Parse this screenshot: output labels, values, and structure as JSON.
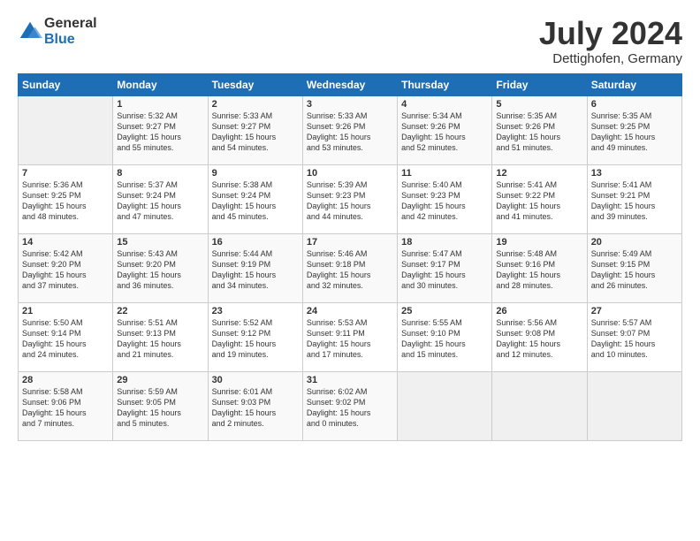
{
  "logo": {
    "general": "General",
    "blue": "Blue"
  },
  "header": {
    "month": "July 2024",
    "location": "Dettighofen, Germany"
  },
  "days_of_week": [
    "Sunday",
    "Monday",
    "Tuesday",
    "Wednesday",
    "Thursday",
    "Friday",
    "Saturday"
  ],
  "weeks": [
    [
      {
        "num": "",
        "info": ""
      },
      {
        "num": "1",
        "info": "Sunrise: 5:32 AM\nSunset: 9:27 PM\nDaylight: 15 hours\nand 55 minutes."
      },
      {
        "num": "2",
        "info": "Sunrise: 5:33 AM\nSunset: 9:27 PM\nDaylight: 15 hours\nand 54 minutes."
      },
      {
        "num": "3",
        "info": "Sunrise: 5:33 AM\nSunset: 9:26 PM\nDaylight: 15 hours\nand 53 minutes."
      },
      {
        "num": "4",
        "info": "Sunrise: 5:34 AM\nSunset: 9:26 PM\nDaylight: 15 hours\nand 52 minutes."
      },
      {
        "num": "5",
        "info": "Sunrise: 5:35 AM\nSunset: 9:26 PM\nDaylight: 15 hours\nand 51 minutes."
      },
      {
        "num": "6",
        "info": "Sunrise: 5:35 AM\nSunset: 9:25 PM\nDaylight: 15 hours\nand 49 minutes."
      }
    ],
    [
      {
        "num": "7",
        "info": "Sunrise: 5:36 AM\nSunset: 9:25 PM\nDaylight: 15 hours\nand 48 minutes."
      },
      {
        "num": "8",
        "info": "Sunrise: 5:37 AM\nSunset: 9:24 PM\nDaylight: 15 hours\nand 47 minutes."
      },
      {
        "num": "9",
        "info": "Sunrise: 5:38 AM\nSunset: 9:24 PM\nDaylight: 15 hours\nand 45 minutes."
      },
      {
        "num": "10",
        "info": "Sunrise: 5:39 AM\nSunset: 9:23 PM\nDaylight: 15 hours\nand 44 minutes."
      },
      {
        "num": "11",
        "info": "Sunrise: 5:40 AM\nSunset: 9:23 PM\nDaylight: 15 hours\nand 42 minutes."
      },
      {
        "num": "12",
        "info": "Sunrise: 5:41 AM\nSunset: 9:22 PM\nDaylight: 15 hours\nand 41 minutes."
      },
      {
        "num": "13",
        "info": "Sunrise: 5:41 AM\nSunset: 9:21 PM\nDaylight: 15 hours\nand 39 minutes."
      }
    ],
    [
      {
        "num": "14",
        "info": "Sunrise: 5:42 AM\nSunset: 9:20 PM\nDaylight: 15 hours\nand 37 minutes."
      },
      {
        "num": "15",
        "info": "Sunrise: 5:43 AM\nSunset: 9:20 PM\nDaylight: 15 hours\nand 36 minutes."
      },
      {
        "num": "16",
        "info": "Sunrise: 5:44 AM\nSunset: 9:19 PM\nDaylight: 15 hours\nand 34 minutes."
      },
      {
        "num": "17",
        "info": "Sunrise: 5:46 AM\nSunset: 9:18 PM\nDaylight: 15 hours\nand 32 minutes."
      },
      {
        "num": "18",
        "info": "Sunrise: 5:47 AM\nSunset: 9:17 PM\nDaylight: 15 hours\nand 30 minutes."
      },
      {
        "num": "19",
        "info": "Sunrise: 5:48 AM\nSunset: 9:16 PM\nDaylight: 15 hours\nand 28 minutes."
      },
      {
        "num": "20",
        "info": "Sunrise: 5:49 AM\nSunset: 9:15 PM\nDaylight: 15 hours\nand 26 minutes."
      }
    ],
    [
      {
        "num": "21",
        "info": "Sunrise: 5:50 AM\nSunset: 9:14 PM\nDaylight: 15 hours\nand 24 minutes."
      },
      {
        "num": "22",
        "info": "Sunrise: 5:51 AM\nSunset: 9:13 PM\nDaylight: 15 hours\nand 21 minutes."
      },
      {
        "num": "23",
        "info": "Sunrise: 5:52 AM\nSunset: 9:12 PM\nDaylight: 15 hours\nand 19 minutes."
      },
      {
        "num": "24",
        "info": "Sunrise: 5:53 AM\nSunset: 9:11 PM\nDaylight: 15 hours\nand 17 minutes."
      },
      {
        "num": "25",
        "info": "Sunrise: 5:55 AM\nSunset: 9:10 PM\nDaylight: 15 hours\nand 15 minutes."
      },
      {
        "num": "26",
        "info": "Sunrise: 5:56 AM\nSunset: 9:08 PM\nDaylight: 15 hours\nand 12 minutes."
      },
      {
        "num": "27",
        "info": "Sunrise: 5:57 AM\nSunset: 9:07 PM\nDaylight: 15 hours\nand 10 minutes."
      }
    ],
    [
      {
        "num": "28",
        "info": "Sunrise: 5:58 AM\nSunset: 9:06 PM\nDaylight: 15 hours\nand 7 minutes."
      },
      {
        "num": "29",
        "info": "Sunrise: 5:59 AM\nSunset: 9:05 PM\nDaylight: 15 hours\nand 5 minutes."
      },
      {
        "num": "30",
        "info": "Sunrise: 6:01 AM\nSunset: 9:03 PM\nDaylight: 15 hours\nand 2 minutes."
      },
      {
        "num": "31",
        "info": "Sunrise: 6:02 AM\nSunset: 9:02 PM\nDaylight: 15 hours\nand 0 minutes."
      },
      {
        "num": "",
        "info": ""
      },
      {
        "num": "",
        "info": ""
      },
      {
        "num": "",
        "info": ""
      }
    ]
  ]
}
